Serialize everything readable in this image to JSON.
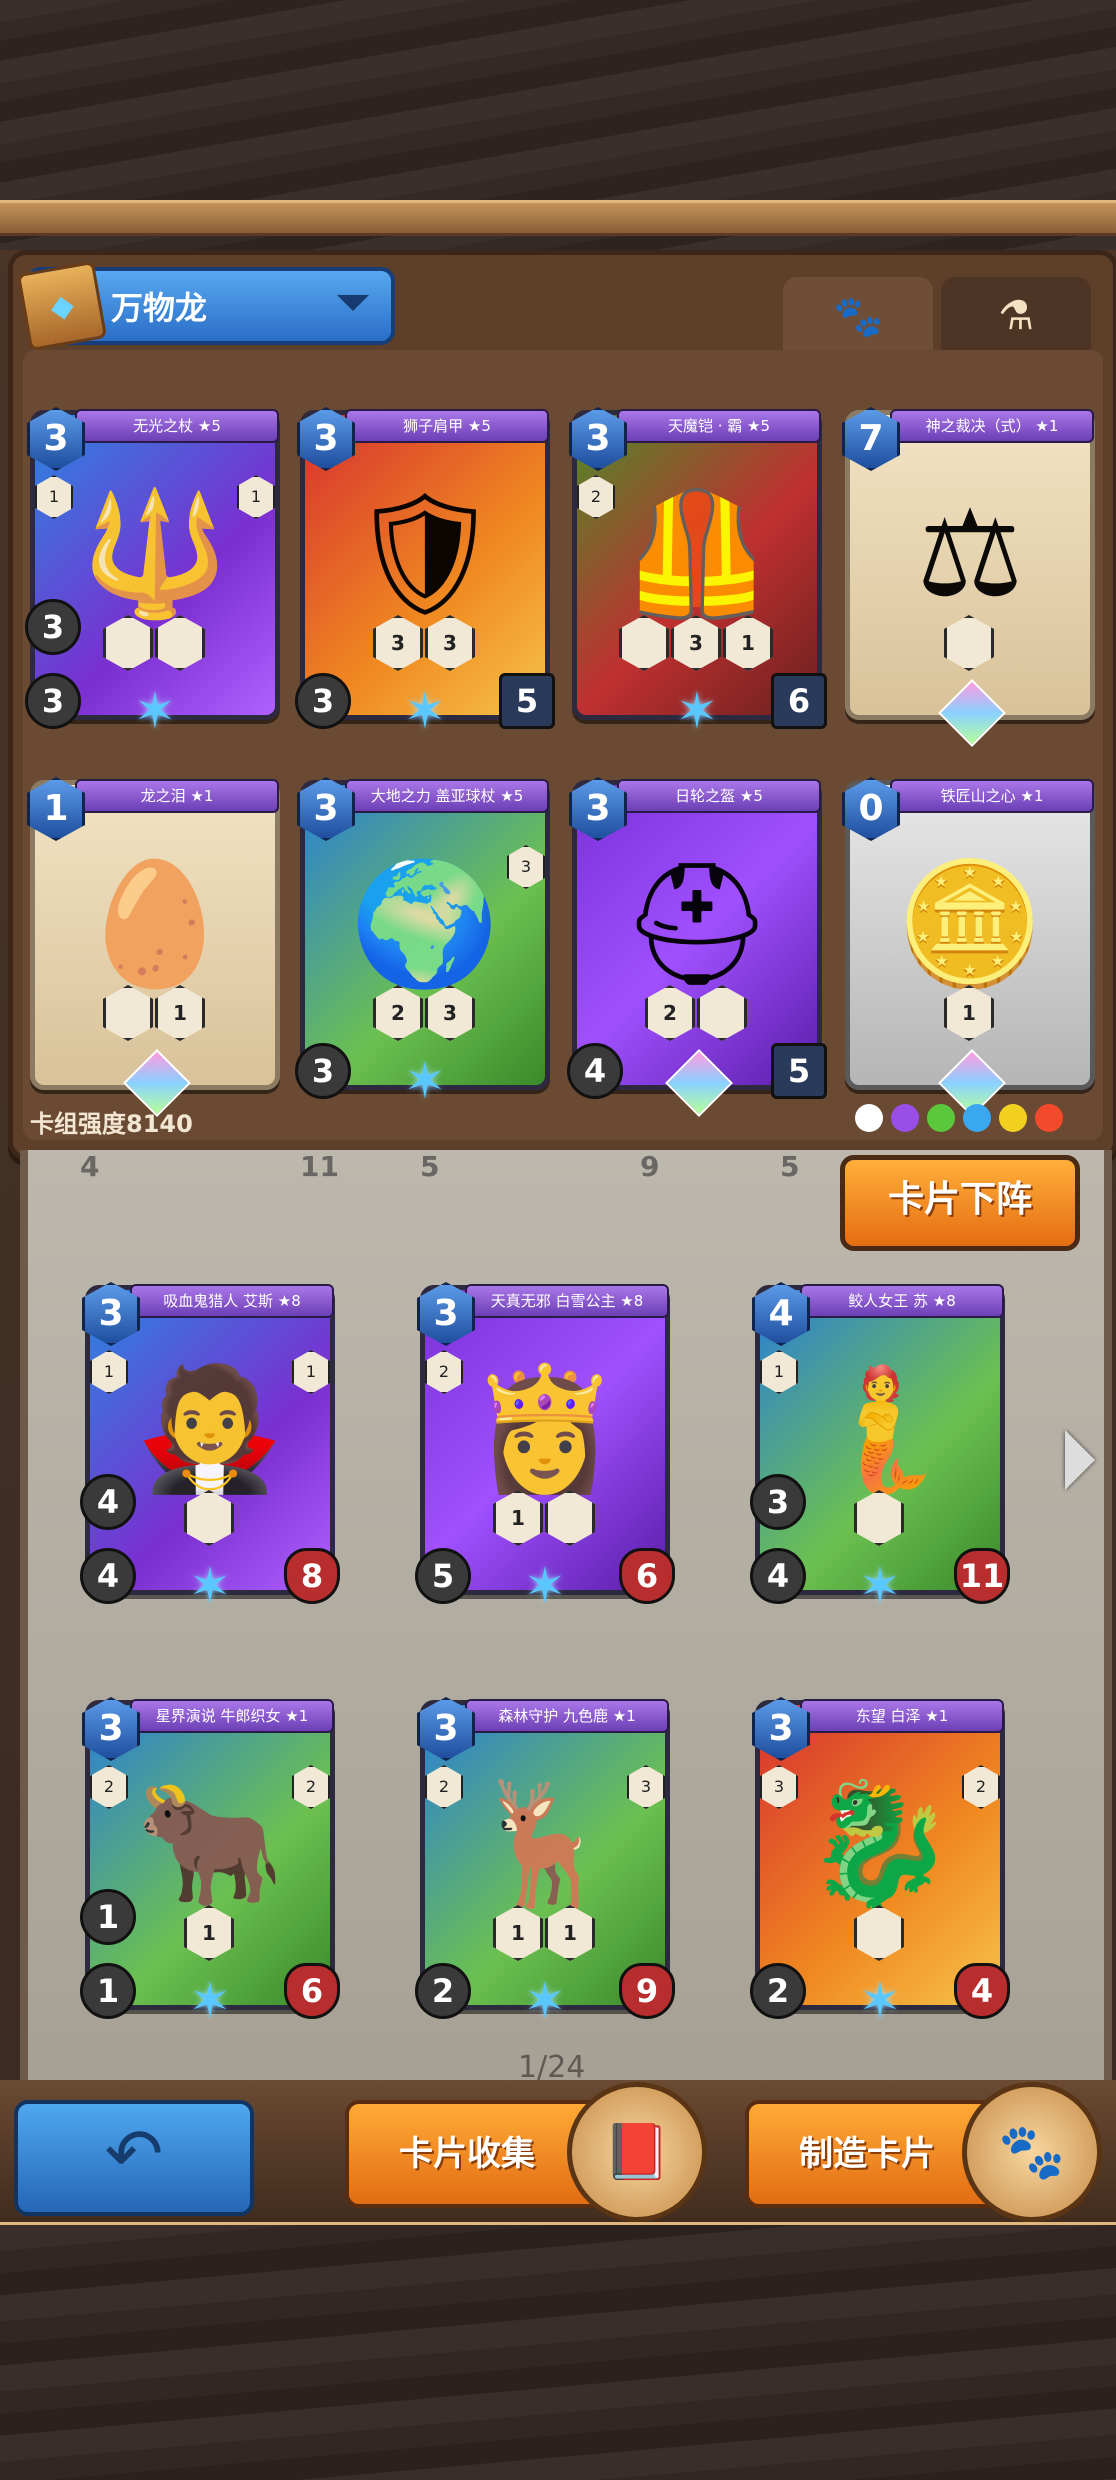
{
  "deck": {
    "name": "万物龙",
    "strength_label": "卡组强度8140"
  },
  "deck_cards": [
    {
      "name": "无光之杖 ★5",
      "cost": "3",
      "atk": "3",
      "hp": "",
      "side_left": "1",
      "side_right": "1",
      "left_extra": "3",
      "skills": [
        "",
        ""
      ],
      "theme": "purple",
      "bottom": "star",
      "art": "🔱"
    },
    {
      "name": "狮子肩甲 ★5",
      "cost": "3",
      "atk": "3",
      "hp": "5",
      "side_left": "",
      "side_right": "",
      "left_extra": "",
      "skills": [
        "3",
        "3"
      ],
      "theme": "red",
      "bottom": "star",
      "art": "🛡"
    },
    {
      "name": "天魔铠 · 霸 ★5",
      "cost": "3",
      "atk": "",
      "hp": "6",
      "side_left": "2",
      "side_right": "",
      "left_extra": "",
      "skills": [
        "",
        "3",
        "1"
      ],
      "theme": "green",
      "bottom": "star",
      "art": "🦺"
    },
    {
      "name": "神之裁决（式） ★1",
      "cost": "7",
      "atk": "",
      "hp": "",
      "side_left": "",
      "side_right": "",
      "left_extra": "",
      "skills": [
        ""
      ],
      "theme": "cream",
      "bottom": "gem",
      "art": "⚖"
    },
    {
      "name": "龙之泪 ★1",
      "cost": "1",
      "atk": "",
      "hp": "",
      "side_left": "",
      "side_right": "",
      "left_extra": "",
      "skills": [
        "",
        "1"
      ],
      "theme": "cream",
      "bottom": "gem",
      "art": "🥚"
    },
    {
      "name": "大地之力 盖亚球杖 ★5",
      "cost": "3",
      "atk": "3",
      "hp": "",
      "side_left": "",
      "side_right": "3",
      "left_extra": "",
      "skills": [
        "2",
        "3"
      ],
      "theme": "blue-green",
      "bottom": "star",
      "art": "🌍"
    },
    {
      "name": "日轮之盔 ★5",
      "cost": "3",
      "atk": "4",
      "hp": "5",
      "side_left": "",
      "side_right": "",
      "left_extra": "",
      "skills": [
        "2",
        ""
      ],
      "theme": "violet",
      "bottom": "gem",
      "art": "⛑"
    },
    {
      "name": "铁匠山之心 ★1",
      "cost": "0",
      "atk": "",
      "hp": "",
      "side_left": "",
      "side_right": "",
      "left_extra": "",
      "skills": [
        "1"
      ],
      "theme": "gold",
      "bottom": "gem",
      "art": "🪙"
    }
  ],
  "collection_cards": [
    {
      "name": "吸血鬼猎人 艾斯 ★8",
      "cost": "3",
      "atk": "4",
      "hp": "8",
      "side_left": "1",
      "side_right": "1",
      "left_extra": "4",
      "skills": [
        ""
      ],
      "theme": "purple",
      "art": "🧛"
    },
    {
      "name": "天真无邪 白雪公主 ★8",
      "cost": "3",
      "atk": "5",
      "hp": "6",
      "side_left": "2",
      "side_right": "",
      "left_extra": "",
      "skills": [
        "1",
        ""
      ],
      "theme": "violet",
      "art": "👸"
    },
    {
      "name": "鲛人女王 苏 ★8",
      "cost": "4",
      "atk": "4",
      "hp": "11",
      "side_left": "1",
      "side_right": "",
      "left_extra": "3",
      "skills": [
        ""
      ],
      "theme": "blue-green",
      "art": "🧜"
    },
    {
      "name": "星界演说 牛郎织女 ★1",
      "cost": "3",
      "atk": "1",
      "hp": "6",
      "side_left": "2",
      "side_right": "2",
      "left_extra": "1",
      "skills": [
        "1"
      ],
      "theme": "blue-green",
      "art": "🐂"
    },
    {
      "name": "森林守护 九色鹿 ★1",
      "cost": "3",
      "atk": "2",
      "hp": "9",
      "side_left": "2",
      "side_right": "3",
      "left_extra": "",
      "skills": [
        "1",
        "1"
      ],
      "theme": "blue-green",
      "art": "🦌"
    },
    {
      "name": "东望 白泽 ★1",
      "cost": "3",
      "atk": "2",
      "hp": "4",
      "side_left": "3",
      "side_right": "2",
      "left_extra": "",
      "skills": [
        ""
      ],
      "theme": "red",
      "art": "🐉"
    }
  ],
  "partial_row": [
    "4",
    "11",
    "5",
    "9",
    "5"
  ],
  "buttons": {
    "withdraw": "卡片下阵",
    "collection": "卡片收集",
    "craft": "制造卡片",
    "back_icon": "back-arrow-icon"
  },
  "pagination": "1/24",
  "element_colors": [
    "#ffffff",
    "#9a4ee8",
    "#5ac83a",
    "#3aa8f0",
    "#f2d020",
    "#f24a2a"
  ]
}
